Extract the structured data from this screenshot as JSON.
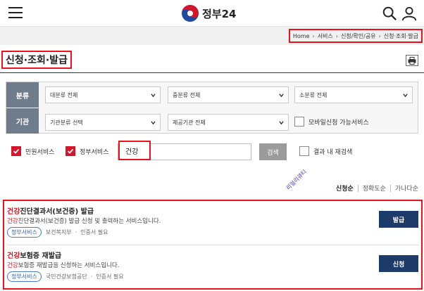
{
  "header": {
    "logo_text": "정부24",
    "menu_icon": "hamburger-menu-icon",
    "search_icon": "search-icon",
    "user_icon": "user-icon"
  },
  "breadcrumb": [
    "Home",
    "서비스",
    "신청/확인/공유",
    "신청·조회·발급"
  ],
  "page": {
    "title": "신청·조회·발급",
    "print_icon": "print-icon"
  },
  "filter": {
    "category_label": "분류",
    "agency_label": "기관",
    "major": "대분류 전체",
    "middle": "중분류 전체",
    "minor": "소분류 전체",
    "agency_select": "기관분류 선택",
    "provider": "제공기관 전체",
    "mobile_label": "모바일신청 가능서비스",
    "mobile_checked": false
  },
  "search": {
    "civil_label": "민원서비스",
    "civil_checked": true,
    "gov_label": "정부서비스",
    "gov_checked": true,
    "query": "건강",
    "button": "검색",
    "research_label": "결과 내 재검색",
    "research_checked": false
  },
  "sort": {
    "items": [
      "신청순",
      "정확도순",
      "가나다순"
    ],
    "active": 0
  },
  "side_label": "리얼리큐티",
  "results": [
    {
      "title_highlight": "건강",
      "title_rest": "진단결과서(보건증) 발급",
      "desc_highlight": "건강",
      "desc_rest": "진단결과서(보건증) 발급 신청 및 출력하는 서비스입니다.",
      "tag": "정부서비스",
      "org": "보건복지부",
      "auth": "인증서 필요",
      "button": "발급"
    },
    {
      "title_highlight": "건강",
      "title_rest": "보험증 재발급",
      "desc_highlight": "건강",
      "desc_rest": "보험증 재발급을 신청하는 서비스입니다.",
      "tag": "정부서비스",
      "org": "국민건강보험공단",
      "auth": "인증서 필요",
      "button": "신청"
    }
  ],
  "colors": {
    "accent_red": "#e8131d",
    "navy_button": "#1c3b6b",
    "label_gray": "#6f7c8c"
  }
}
